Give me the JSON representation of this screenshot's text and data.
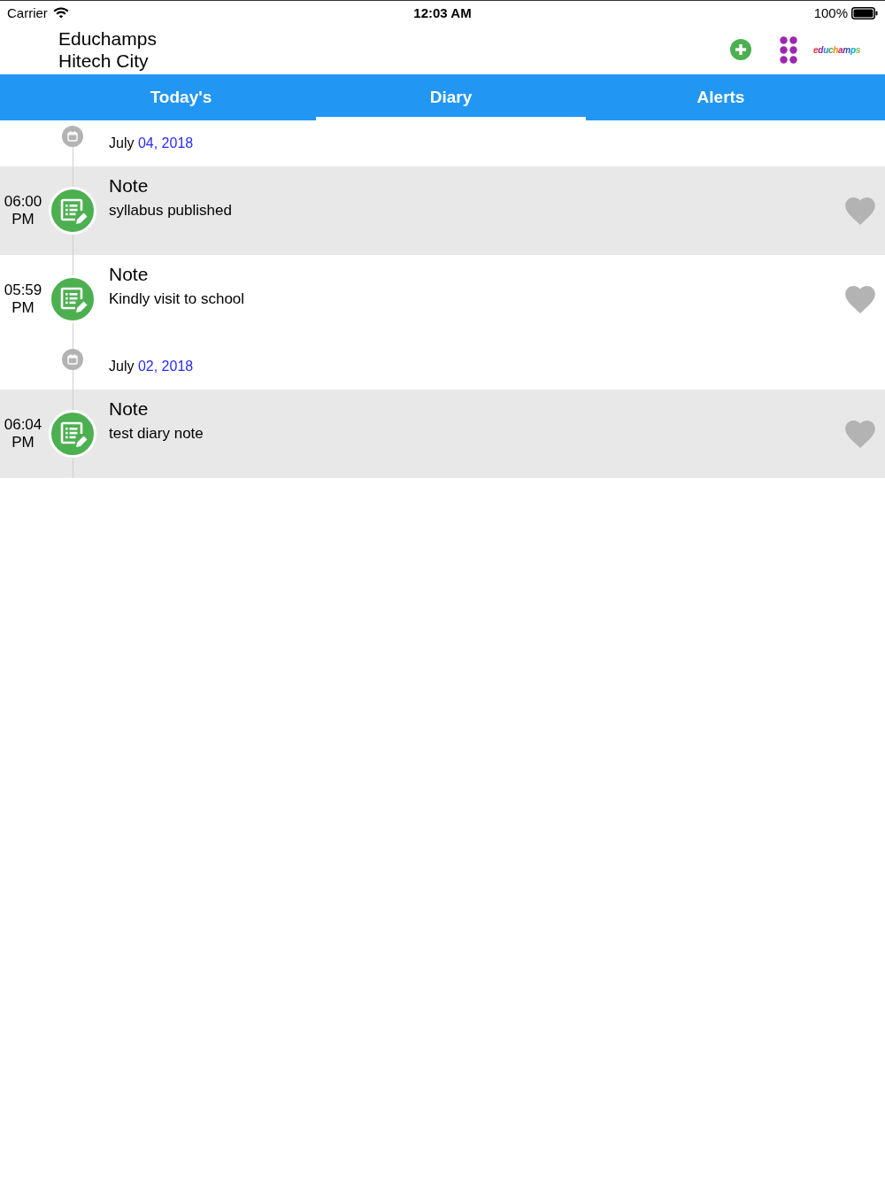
{
  "status_bar": {
    "carrier": "Carrier",
    "time": "12:03 AM",
    "battery": "100%"
  },
  "header": {
    "title": "Educhamps",
    "subtitle": "Hitech City",
    "logo": "educhamps"
  },
  "tabs": [
    {
      "label": "Today's",
      "selected": false
    },
    {
      "label": "Diary",
      "selected": true
    },
    {
      "label": "Alerts",
      "selected": false
    }
  ],
  "diary": [
    {
      "month": "July",
      "date": "04, 2018",
      "entries": [
        {
          "time": "06:00 PM",
          "title": "Note",
          "text": "syllabus published",
          "liked": false
        },
        {
          "time": "05:59 PM",
          "title": "Note",
          "text": "Kindly visit to school",
          "liked": false
        }
      ]
    },
    {
      "month": "July",
      "date": "02, 2018",
      "entries": [
        {
          "time": "06:04 PM",
          "title": "Note",
          "text": "test diary note",
          "liked": false
        }
      ]
    }
  ]
}
